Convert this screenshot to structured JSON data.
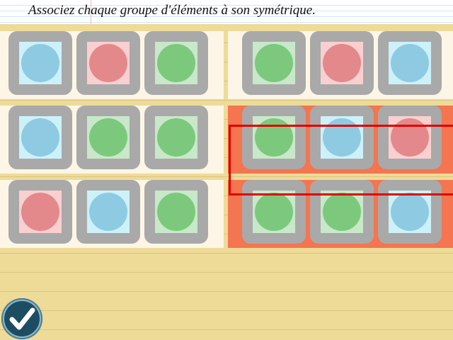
{
  "instruction": "Associez chaque groupe d'éléments à son symétrique.",
  "colors": {
    "blue_square": "#cdf1f9",
    "blue_dot": "#8ecbe2",
    "red_square": "#f9cfd0",
    "red_dot": "#e3898b",
    "green_square": "#c8e8c9",
    "green_dot": "#7cc97d",
    "highlight_band": "#f4754f",
    "selection_border": "#e00000"
  },
  "left_groups": [
    [
      "blue",
      "red",
      "green"
    ],
    [
      "blue",
      "green",
      "green"
    ],
    [
      "red",
      "blue",
      "green"
    ]
  ],
  "right_groups": [
    [
      "green",
      "red",
      "blue"
    ],
    [
      "green",
      "blue",
      "red"
    ],
    [
      "green",
      "green",
      "blue"
    ]
  ],
  "highlighted_right_rows": [
    1,
    2
  ],
  "selected_right_row": 1,
  "validate_icon": "checkmark-icon"
}
